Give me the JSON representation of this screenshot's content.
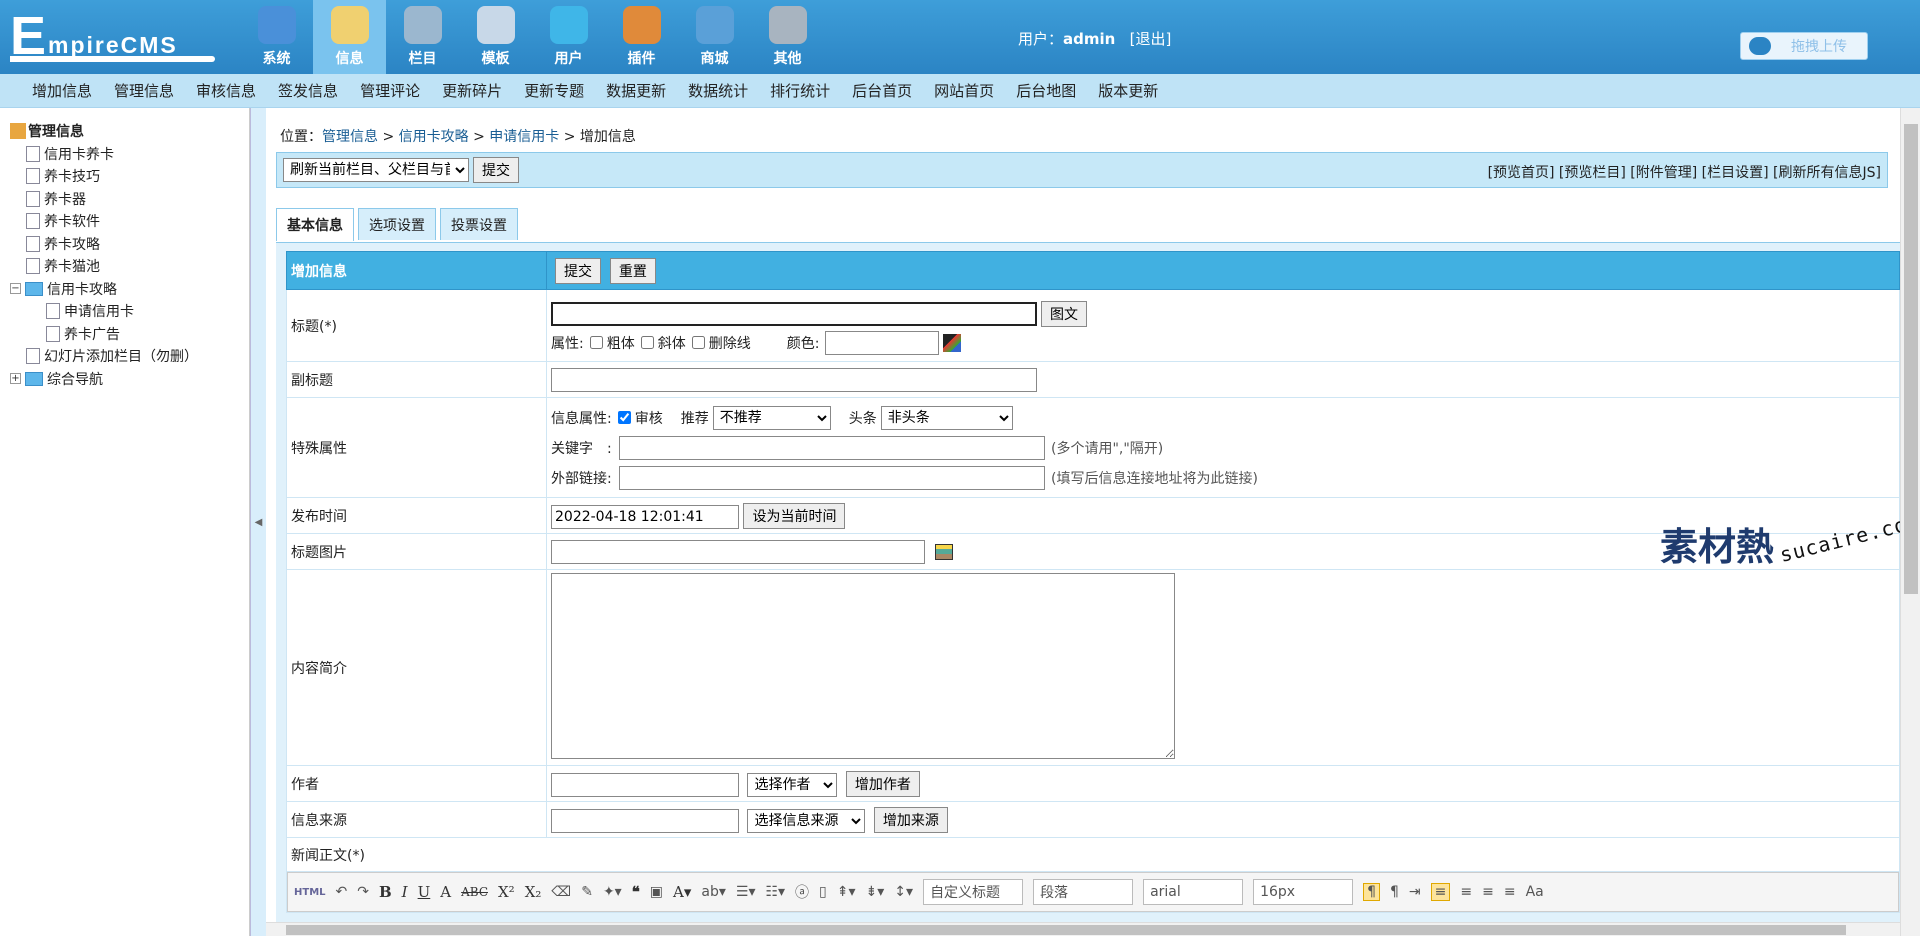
{
  "logo": {
    "big": "E",
    "rest": "mpireCMS"
  },
  "mainnav": [
    {
      "label": "系统",
      "color": "#4a90d9"
    },
    {
      "label": "信息",
      "color": "#f0d070",
      "active": true
    },
    {
      "label": "栏目",
      "color": "#9bb7cf"
    },
    {
      "label": "模板",
      "color": "#c8d8e8"
    },
    {
      "label": "用户",
      "color": "#3fb6e8"
    },
    {
      "label": "插件",
      "color": "#e08a3a"
    },
    {
      "label": "商城",
      "color": "#5aa0d8"
    },
    {
      "label": "其他",
      "color": "#a8b4c0"
    }
  ],
  "user": {
    "prefix": "用户：",
    "name": "admin",
    "logout": "[退出]"
  },
  "upload": {
    "label": "拖拽上传"
  },
  "subnav": [
    "增加信息",
    "管理信息",
    "审核信息",
    "签发信息",
    "管理评论",
    "更新碎片",
    "更新专题",
    "数据更新",
    "数据统计",
    "排行统计",
    "后台首页",
    "网站首页",
    "后台地图",
    "版本更新"
  ],
  "tree": [
    {
      "label": "管理信息",
      "type": "root"
    },
    {
      "label": "信用卡养卡",
      "type": "page",
      "indent": 1
    },
    {
      "label": "养卡技巧",
      "type": "page",
      "indent": 1
    },
    {
      "label": "养卡器",
      "type": "page",
      "indent": 1
    },
    {
      "label": "养卡软件",
      "type": "page",
      "indent": 1
    },
    {
      "label": "养卡攻略",
      "type": "page",
      "indent": 1
    },
    {
      "label": "养卡猫池",
      "type": "page",
      "indent": 1
    },
    {
      "label": "信用卡攻略",
      "type": "folder-open",
      "indent": 0
    },
    {
      "label": "申请信用卡",
      "type": "page",
      "indent": 2
    },
    {
      "label": "养卡广告",
      "type": "page",
      "indent": 2
    },
    {
      "label": "幻灯片添加栏目（勿删）",
      "type": "page",
      "indent": 1
    },
    {
      "label": "综合导航",
      "type": "folder-closed",
      "indent": 0
    }
  ],
  "crumb": {
    "prefix": "位置：",
    "items": [
      "管理信息",
      "信用卡攻略",
      "申请信用卡"
    ],
    "current": "增加信息",
    "sep": " > "
  },
  "toolbar": {
    "refresh_select": "刷新当前栏目、父栏目与首页",
    "submit": "提交",
    "links": "[预览首页] [预览栏目] [附件管理] [栏目设置] [刷新所有信息JS]"
  },
  "tabs": [
    "基本信息",
    "选项设置",
    "投票设置"
  ],
  "form": {
    "header": "增加信息",
    "submit": "提交",
    "reset": "重置",
    "title_label": "标题(*)",
    "title_btn": "图文",
    "attr_label": "属性:",
    "attr_bold": "粗体",
    "attr_italic": "斜体",
    "attr_strike": "删除线",
    "color_label": "颜色:",
    "subtitle_label": "副标题",
    "special_label": "特殊属性",
    "info_attr": "信息属性:",
    "audit": "审核",
    "recommend": "推荐",
    "recommend_val": "不推荐",
    "headline": "头条",
    "headline_val": "非头条",
    "keyword_label": "关键字　:",
    "keyword_hint": "(多个请用\",\"隔开)",
    "link_label": "外部链接:",
    "link_hint": "(填写后信息连接地址将为此链接)",
    "pubtime_label": "发布时间",
    "pubtime_val": "2022-04-18 12:01:41",
    "pubtime_btn": "设为当前时间",
    "titlepic_label": "标题图片",
    "summary_label": "内容简介",
    "author_label": "作者",
    "author_select": "选择作者",
    "author_btn": "增加作者",
    "source_label": "信息来源",
    "source_select": "选择信息来源",
    "source_btn": "增加来源",
    "body_label": "新闻正文(*)"
  },
  "editor": {
    "html": "HTML",
    "custom_title": "自定义标题",
    "paragraph": "段落",
    "font": "arial",
    "size": "16px"
  },
  "watermark": {
    "cn": "素材熱",
    "en": "sucaire.com"
  }
}
